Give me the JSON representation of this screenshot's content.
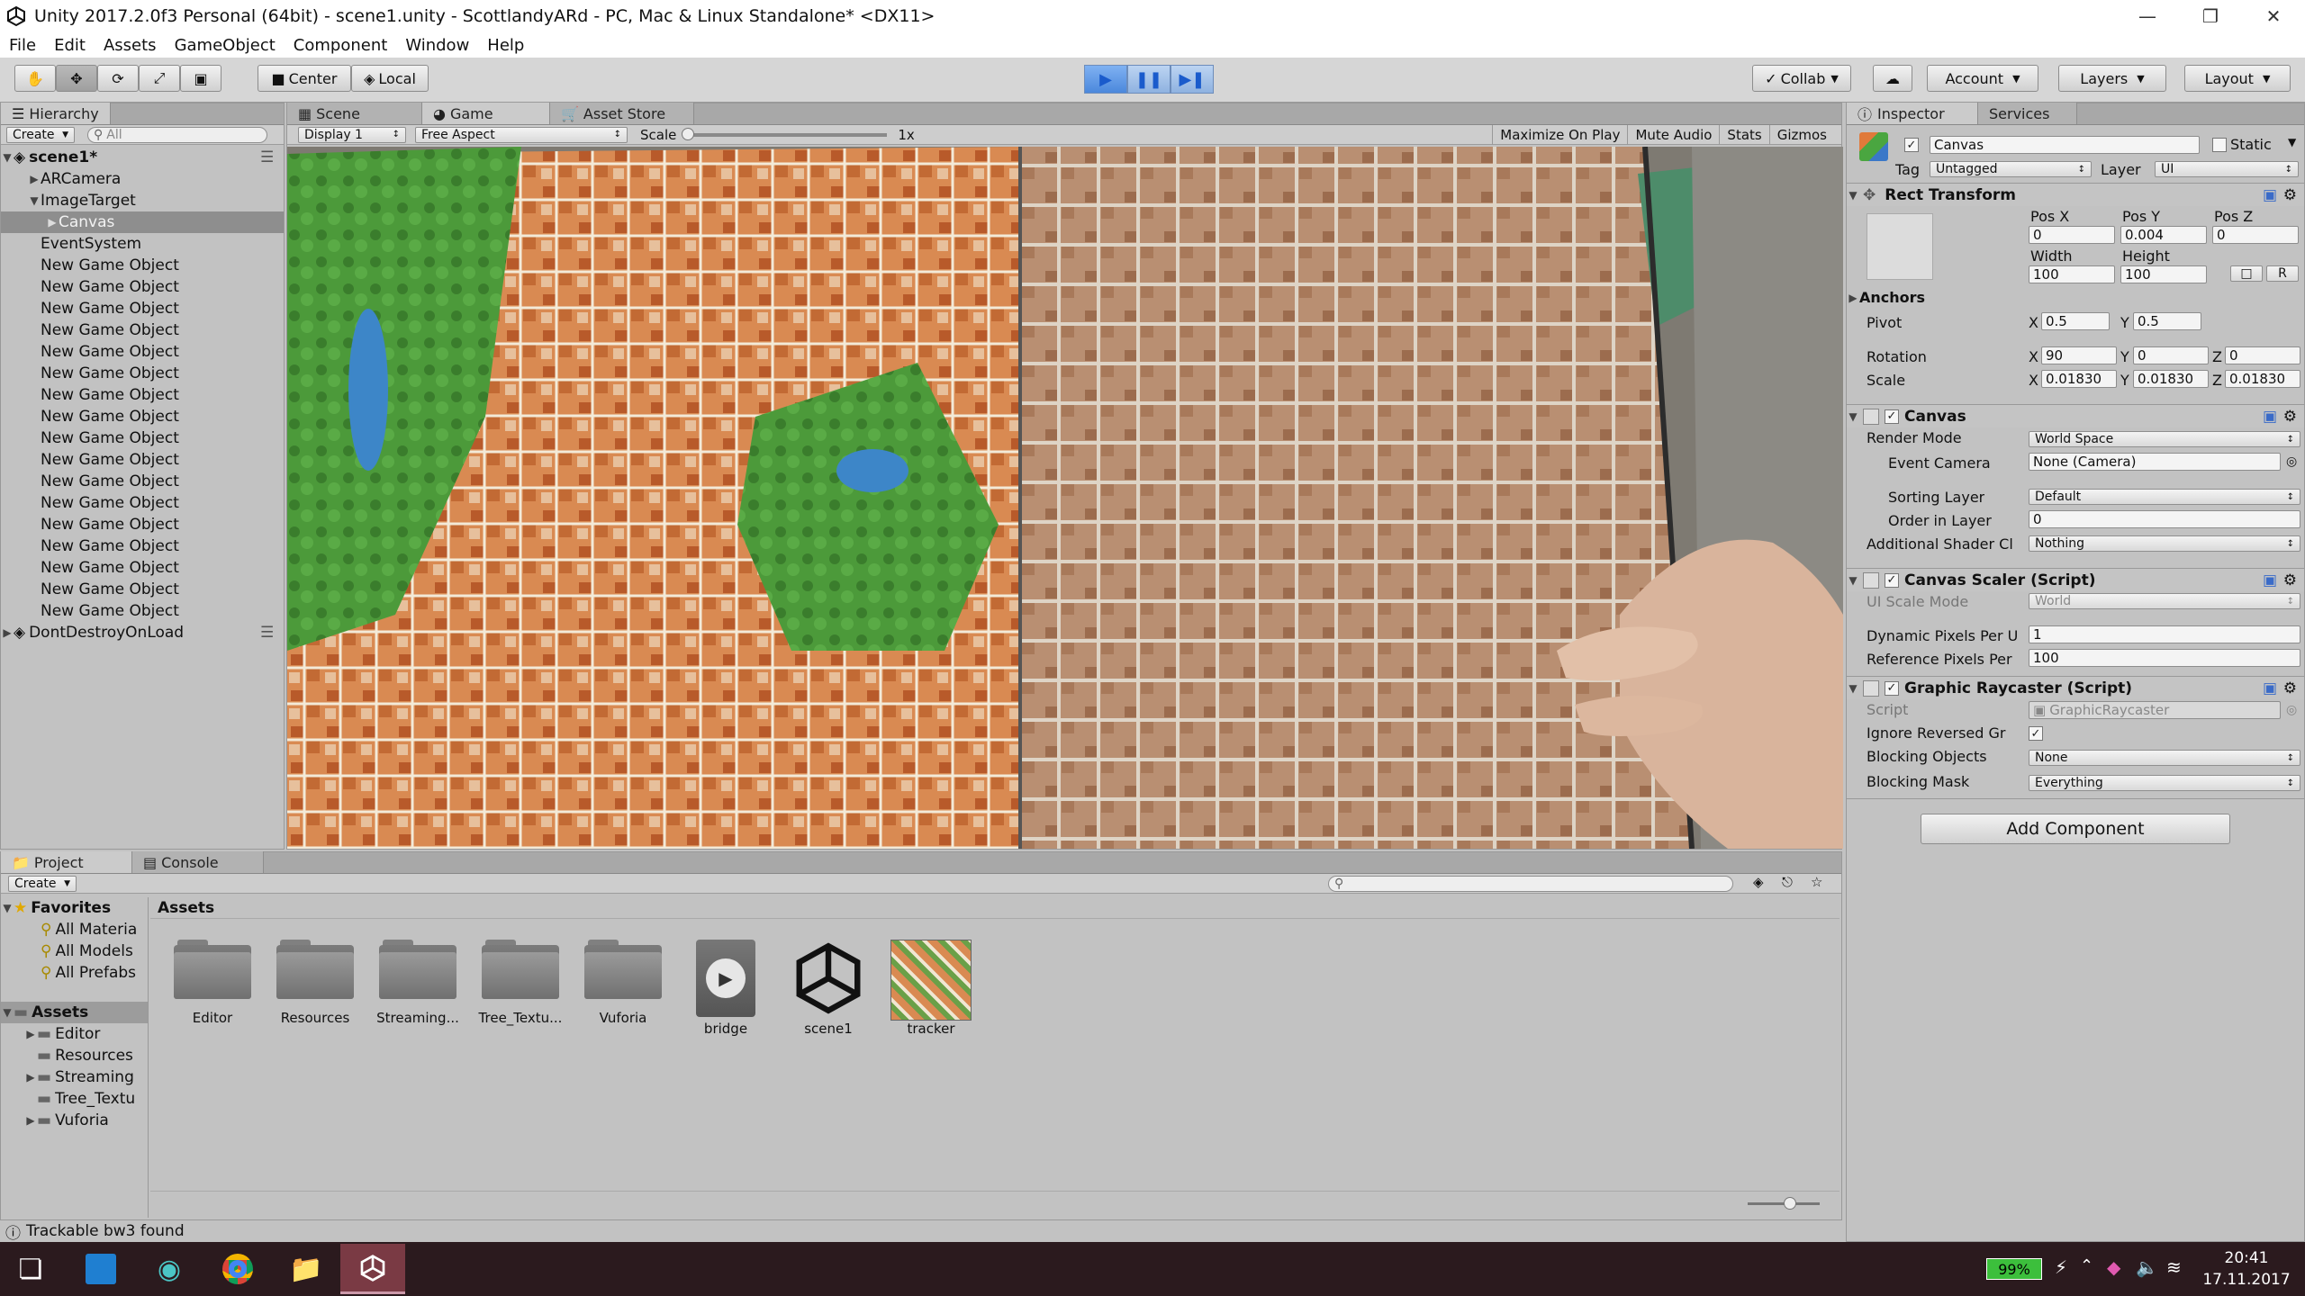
{
  "window": {
    "title": "Unity 2017.2.0f3 Personal (64bit) - scene1.unity - ScottlandyARd - PC, Mac & Linux Standalone* <DX11>"
  },
  "menu": [
    "File",
    "Edit",
    "Assets",
    "GameObject",
    "Component",
    "Window",
    "Help"
  ],
  "toolbar": {
    "pivot": "Center",
    "space": "Local",
    "collab": "Collab",
    "account": "Account",
    "layers": "Layers",
    "layout": "Layout"
  },
  "hierarchy": {
    "tab": "Hierarchy",
    "create": "Create",
    "search_placeholder": "All",
    "scene": "scene1*",
    "items": [
      "ARCamera",
      "ImageTarget",
      "Canvas",
      "EventSystem",
      "New Game Object",
      "New Game Object",
      "New Game Object",
      "New Game Object",
      "New Game Object",
      "New Game Object",
      "New Game Object",
      "New Game Object",
      "New Game Object",
      "New Game Object",
      "New Game Object",
      "New Game Object",
      "New Game Object",
      "New Game Object",
      "New Game Object",
      "New Game Object",
      "New Game Object"
    ],
    "dontdestroy": "DontDestroyOnLoad"
  },
  "gameview": {
    "tabs": [
      "Scene",
      "Game",
      "Asset Store"
    ],
    "display": "Display 1",
    "aspect": "Free Aspect",
    "scale_label": "Scale",
    "scale_value": "1x",
    "maximize": "Maximize On Play",
    "mute": "Mute Audio",
    "stats": "Stats",
    "gizmos": "Gizmos"
  },
  "inspector": {
    "tabs": [
      "Inspector",
      "Services"
    ],
    "object_name": "Canvas",
    "static": "Static",
    "tag_label": "Tag",
    "tag": "Untagged",
    "layer_label": "Layer",
    "layer": "UI",
    "rect": {
      "title": "Rect Transform",
      "posx_label": "Pos X",
      "posy_label": "Pos Y",
      "posz_label": "Pos Z",
      "posx": "0",
      "posy": "0.004",
      "posz": "0",
      "width_label": "Width",
      "height_label": "Height",
      "width": "100",
      "height": "100",
      "r_btn": "R",
      "anchors": "Anchors",
      "pivot_label": "Pivot",
      "pivot_x": "0.5",
      "pivot_y": "0.5",
      "rotation_label": "Rotation",
      "rot_x": "90",
      "rot_y": "0",
      "rot_z": "0",
      "scale_label": "Scale",
      "scale_x": "0.01830",
      "scale_y": "0.01830",
      "scale_z": "0.01830"
    },
    "canvas": {
      "title": "Canvas",
      "render_mode_label": "Render Mode",
      "render_mode": "World Space",
      "event_camera_label": "Event Camera",
      "event_camera": "None (Camera)",
      "sorting_layer_label": "Sorting Layer",
      "sorting_layer": "Default",
      "order_label": "Order in Layer",
      "order": "0",
      "shader_label": "Additional Shader Cl",
      "shader": "Nothing"
    },
    "scaler": {
      "title": "Canvas Scaler (Script)",
      "ui_scale_label": "UI Scale Mode",
      "ui_scale": "World",
      "dyn_label": "Dynamic Pixels Per U",
      "dyn": "1",
      "ref_label": "Reference Pixels Per",
      "ref": "100"
    },
    "raycaster": {
      "title": "Graphic Raycaster (Script)",
      "script_label": "Script",
      "script": "GraphicRaycaster",
      "ignore_label": "Ignore Reversed Gr",
      "blocking_label": "Blocking Objects",
      "blocking": "None",
      "mask_label": "Blocking Mask",
      "mask": "Everything"
    },
    "add_component": "Add Component"
  },
  "project": {
    "tabs": [
      "Project",
      "Console"
    ],
    "create": "Create",
    "favorites": "Favorites",
    "fav_items": [
      "All Materia",
      "All Models",
      "All Prefabs"
    ],
    "assets_root": "Assets",
    "tree": [
      "Editor",
      "Resources",
      "Streaming",
      "Tree_Textu",
      "Vuforia"
    ],
    "assets_header": "Assets",
    "assets": [
      "Editor",
      "Resources",
      "Streaming...",
      "Tree_Textu...",
      "Vuforia",
      "bridge",
      "scene1",
      "tracker"
    ]
  },
  "status": "Trackable bw3 found",
  "taskbar": {
    "battery": "99%",
    "time": "20:41",
    "date": "17.11.2017"
  },
  "colors": {
    "play_active": "#1a5bcc",
    "taskbar_bg": "#2b1a1e",
    "selection": "#8e8e8e",
    "battery_green": "#3cbf3c"
  }
}
